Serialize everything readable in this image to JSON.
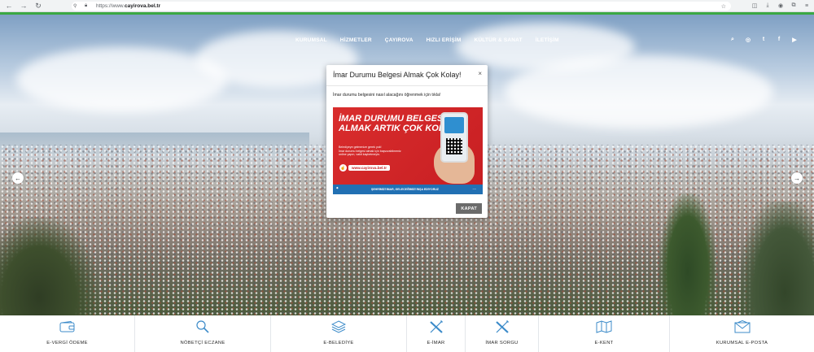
{
  "browser": {
    "url_protocol": "https://www.",
    "url_domain": "cayirova.bel.tr",
    "back_icon": "←",
    "forward_icon": "→",
    "reload_icon": "↻"
  },
  "nav": {
    "items": [
      "KURUMSAL",
      "HİZMETLER",
      "ÇAYIROVA",
      "HIZLI ERİŞİM",
      "KÜLTÜR & SANAT",
      "İLETİŞİM"
    ]
  },
  "social": [
    "⌕",
    "◎",
    "t",
    "f",
    "▶"
  ],
  "slider": {
    "prev": "←",
    "next": "→"
  },
  "modal": {
    "title": "İmar Durumu Belgesi Almak Çok Kolay!",
    "close": "×",
    "body": "İmar durumu belgesini nasıl alacağını öğrenmek için tıkla!",
    "banner_title_1": "İMAR DURUMU BELGESİ",
    "banner_title_2": "ALMAK ARTIK ÇOK KOLAY!",
    "banner_text_1": "Belediyeye gelmenize gerek yok!",
    "banner_text_2": "İmar durumu belgesi almak için başvurabilmeniz",
    "banner_text_3": "online yapın, vakit kaybetmeyin.",
    "banner_url": "www.cayirova.bel.tr",
    "banner_slogan": "ŞEHRİMİZİ İMAR, GELECEĞİMİZİ İNŞA EDİYORUZ",
    "button": "KAPAT"
  },
  "quick_links": [
    {
      "label": "E-VERGİ ÖDEME",
      "icon": "wallet-icon"
    },
    {
      "label": "NÖBETÇİ ECZANE",
      "icon": "search-icon"
    },
    {
      "label": "E-BELEDİYE",
      "icon": "layers-icon"
    },
    {
      "label": "E-İMAR",
      "icon": "ruler-pencil-icon"
    },
    {
      "label": "İMAR SORGU",
      "icon": "ruler-pencil-icon"
    },
    {
      "label": "E-KENT",
      "icon": "map-icon"
    },
    {
      "label": "KURUMSAL E-POSTA",
      "icon": "envelope-icon"
    }
  ],
  "colors": {
    "accent_green": "#3aa843",
    "icon_blue": "#3c8bc9",
    "banner_red": "#c71e22"
  }
}
